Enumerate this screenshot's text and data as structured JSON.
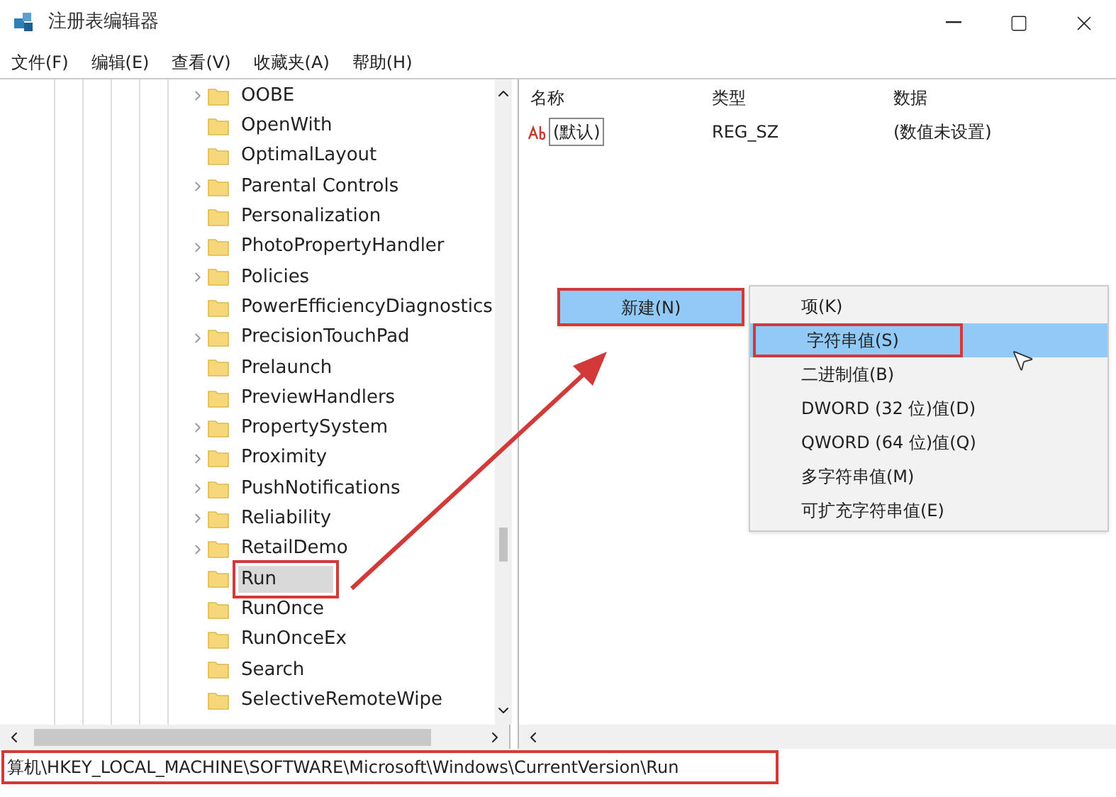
{
  "window": {
    "title": "注册表编辑器"
  },
  "menu_bar": [
    {
      "label": "文件(F)"
    },
    {
      "label": "编辑(E)"
    },
    {
      "label": "查看(V)"
    },
    {
      "label": "收藏夹(A)"
    },
    {
      "label": "帮助(H)"
    }
  ],
  "tree": {
    "items": [
      {
        "label": "OOBE",
        "expandable": true,
        "selected": false,
        "annotated": false
      },
      {
        "label": "OpenWith",
        "expandable": false,
        "selected": false,
        "annotated": false
      },
      {
        "label": "OptimalLayout",
        "expandable": false,
        "selected": false,
        "annotated": false
      },
      {
        "label": "Parental Controls",
        "expandable": true,
        "selected": false,
        "annotated": false
      },
      {
        "label": "Personalization",
        "expandable": false,
        "selected": false,
        "annotated": false
      },
      {
        "label": "PhotoPropertyHandler",
        "expandable": true,
        "selected": false,
        "annotated": false
      },
      {
        "label": "Policies",
        "expandable": true,
        "selected": false,
        "annotated": false
      },
      {
        "label": "PowerEfficiencyDiagnostics",
        "expandable": false,
        "selected": false,
        "annotated": false
      },
      {
        "label": "PrecisionTouchPad",
        "expandable": true,
        "selected": false,
        "annotated": false
      },
      {
        "label": "Prelaunch",
        "expandable": false,
        "selected": false,
        "annotated": false
      },
      {
        "label": "PreviewHandlers",
        "expandable": false,
        "selected": false,
        "annotated": false
      },
      {
        "label": "PropertySystem",
        "expandable": true,
        "selected": false,
        "annotated": false
      },
      {
        "label": "Proximity",
        "expandable": true,
        "selected": false,
        "annotated": false
      },
      {
        "label": "PushNotifications",
        "expandable": true,
        "selected": false,
        "annotated": false
      },
      {
        "label": "Reliability",
        "expandable": true,
        "selected": false,
        "annotated": false
      },
      {
        "label": "RetailDemo",
        "expandable": true,
        "selected": false,
        "annotated": false
      },
      {
        "label": "Run",
        "expandable": false,
        "selected": true,
        "annotated": true
      },
      {
        "label": "RunOnce",
        "expandable": false,
        "selected": false,
        "annotated": false
      },
      {
        "label": "RunOnceEx",
        "expandable": false,
        "selected": false,
        "annotated": false
      },
      {
        "label": "Search",
        "expandable": false,
        "selected": false,
        "annotated": false
      },
      {
        "label": "SelectiveRemoteWipe",
        "expandable": false,
        "selected": false,
        "annotated": false
      }
    ]
  },
  "values_table": {
    "columns": [
      "名称",
      "类型",
      "数据"
    ],
    "rows": [
      {
        "name": "(默认)",
        "type": "REG_SZ",
        "data": "(数值未设置)"
      }
    ]
  },
  "context_menu": {
    "items": [
      {
        "label": "新建(N)",
        "selected": true,
        "annotated": true
      }
    ]
  },
  "submenu": {
    "items": [
      {
        "label": "项(K)",
        "selected": false,
        "annotated": false
      },
      {
        "label": "字符串值(S)",
        "selected": true,
        "annotated": true
      },
      {
        "label": "二进制值(B)",
        "selected": false,
        "annotated": false
      },
      {
        "label": "DWORD (32 位)值(D)",
        "selected": false,
        "annotated": false
      },
      {
        "label": "QWORD (64 位)值(Q)",
        "selected": false,
        "annotated": false
      },
      {
        "label": "多字符串值(M)",
        "selected": false,
        "annotated": false
      },
      {
        "label": "可扩充字符串值(E)",
        "selected": false,
        "annotated": false
      }
    ]
  },
  "status_bar": {
    "path": "算机\\HKEY_LOCAL_MACHINE\\SOFTWARE\\Microsoft\\Windows\\CurrentVersion\\Run",
    "annotated": true
  }
}
